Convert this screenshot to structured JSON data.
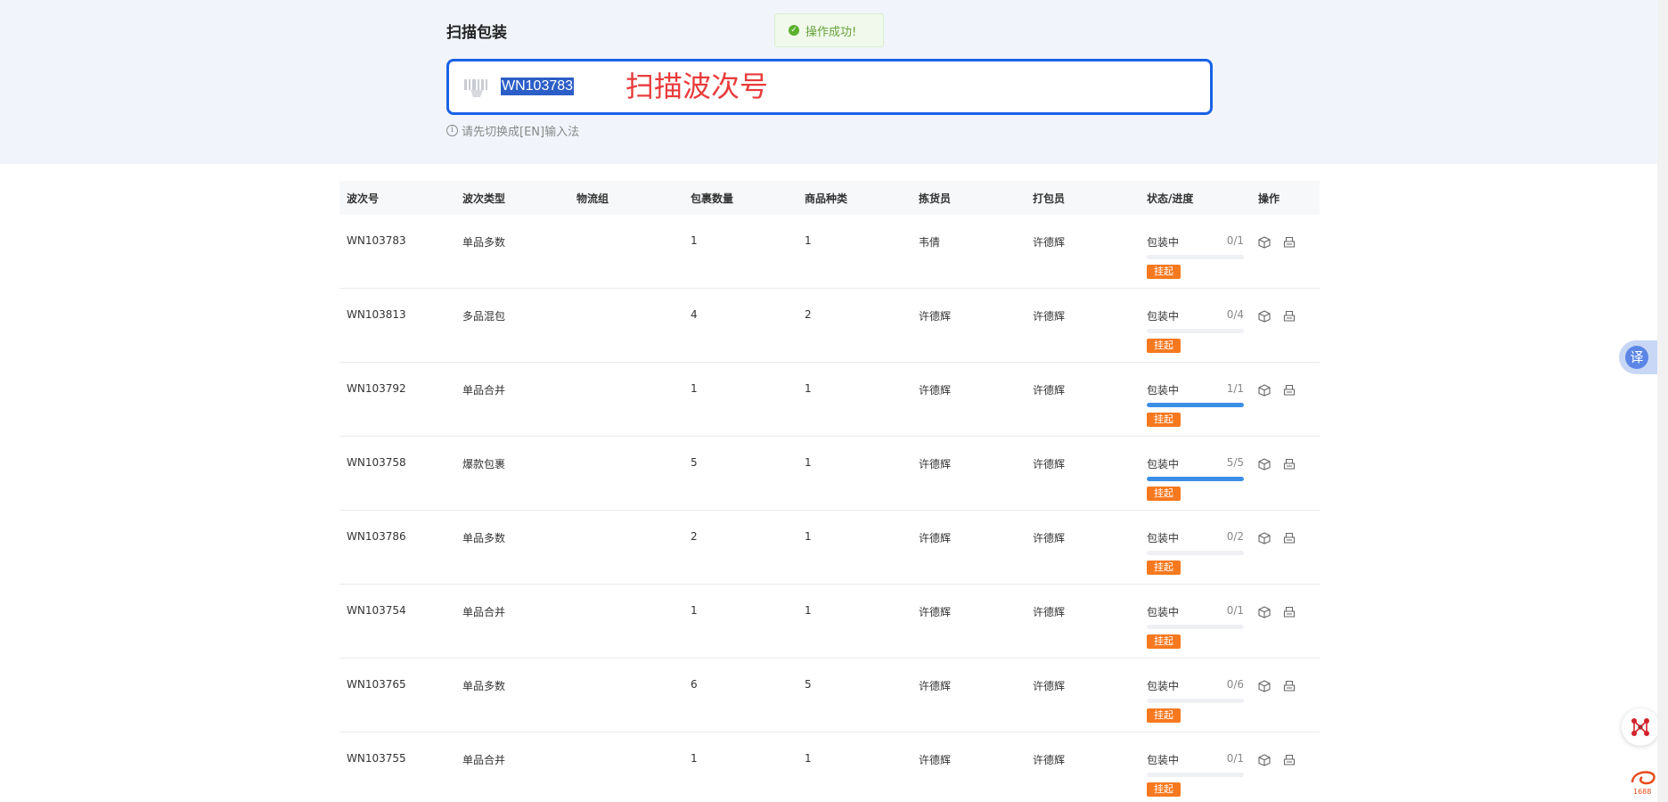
{
  "header": {
    "title": "扫描包装",
    "toast": "操作成功!",
    "scan_value": "WN103783",
    "scan_annotation": "扫描波次号",
    "hint": "请先切换成[EN]输入法"
  },
  "table": {
    "columns": [
      "波次号",
      "波次类型",
      "物流组",
      "包裹数量",
      "商品种类",
      "拣货员",
      "打包员",
      "状态/进度",
      "操作"
    ],
    "rows": [
      {
        "wave": "WN103783",
        "type": "单品多数",
        "group": "",
        "packages": "1",
        "kinds": "1",
        "picker": "韦倩",
        "packer": "许德辉",
        "status": "包装中",
        "progress": "0/1",
        "fill": 0,
        "tag": "挂起"
      },
      {
        "wave": "WN103813",
        "type": "多品混包",
        "group": "",
        "packages": "4",
        "kinds": "2",
        "picker": "许德辉",
        "packer": "许德辉",
        "status": "包装中",
        "progress": "0/4",
        "fill": 0,
        "tag": "挂起"
      },
      {
        "wave": "WN103792",
        "type": "单品合并",
        "group": "",
        "packages": "1",
        "kinds": "1",
        "picker": "许德辉",
        "packer": "许德辉",
        "status": "包装中",
        "progress": "1/1",
        "fill": 1,
        "tag": "挂起"
      },
      {
        "wave": "WN103758",
        "type": "爆款包裹",
        "group": "",
        "packages": "5",
        "kinds": "1",
        "picker": "许德辉",
        "packer": "许德辉",
        "status": "包装中",
        "progress": "5/5",
        "fill": 1,
        "tag": "挂起"
      },
      {
        "wave": "WN103786",
        "type": "单品多数",
        "group": "",
        "packages": "2",
        "kinds": "1",
        "picker": "许德辉",
        "packer": "许德辉",
        "status": "包装中",
        "progress": "0/2",
        "fill": 0,
        "tag": "挂起"
      },
      {
        "wave": "WN103754",
        "type": "单品合并",
        "group": "",
        "packages": "1",
        "kinds": "1",
        "picker": "许德辉",
        "packer": "许德辉",
        "status": "包装中",
        "progress": "0/1",
        "fill": 0,
        "tag": "挂起"
      },
      {
        "wave": "WN103765",
        "type": "单品多数",
        "group": "",
        "packages": "6",
        "kinds": "5",
        "picker": "许德辉",
        "packer": "许德辉",
        "status": "包装中",
        "progress": "0/6",
        "fill": 0,
        "tag": "挂起"
      },
      {
        "wave": "WN103755",
        "type": "单品合并",
        "group": "",
        "packages": "1",
        "kinds": "1",
        "picker": "许德辉",
        "packer": "许德辉",
        "status": "包装中",
        "progress": "0/1",
        "fill": 0,
        "tag": "挂起"
      }
    ]
  },
  "side": {
    "translate_label": "译",
    "badge_text": "1688"
  },
  "colors": {
    "accent": "#1a62e6",
    "progress": "#3a8ee6",
    "tag": "#f7791f",
    "annotation": "#e93b3b",
    "success": "#67a23a"
  },
  "icons": {
    "scan": "barcode-scanner-icon",
    "package": "package-icon",
    "print": "print-icon",
    "toast": "check-circle-icon",
    "hint": "info-icon",
    "translate": "translate-icon",
    "network": "network-icon",
    "brand": "1688-logo-icon"
  }
}
